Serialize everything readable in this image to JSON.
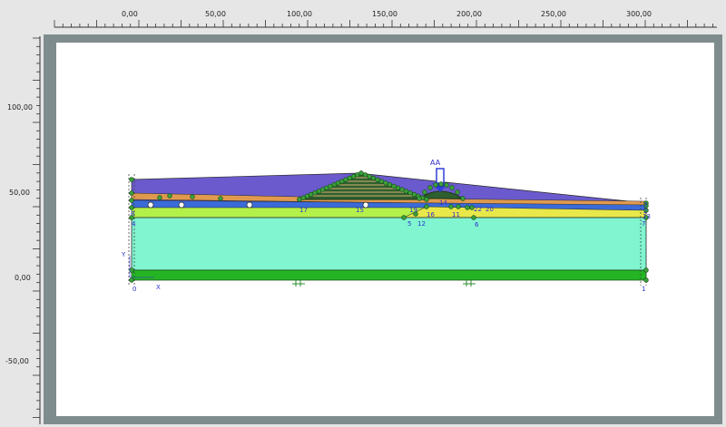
{
  "rulers": {
    "x_ticks": [
      "0,00",
      "50,00",
      "100,00",
      "150,00",
      "200,00",
      "250,00",
      "300,00"
    ],
    "y_ticks": [
      "100,00",
      "50,00",
      "0,00",
      "-50,00"
    ]
  },
  "model": {
    "load_label": "AA",
    "axis_x": "X",
    "axis_y": "Y",
    "point_labels": [
      "0",
      "1",
      "4",
      "7",
      "8",
      "5",
      "12",
      "6",
      "17",
      "15",
      "19",
      "11",
      "14",
      "22",
      "20",
      "13",
      "3",
      "2",
      "16"
    ]
  },
  "colors": {
    "frame": "#7f8c8d",
    "canvas": "#ffffff",
    "layer_purple": "#6a5acd",
    "layer_teal": "#80f5cf",
    "layer_green": "#24b424",
    "layer_yellow": "#e8e84a",
    "layer_lime": "#b4f04a",
    "embankment": "#d99a4a",
    "load_arrow": "#2f3fd8",
    "points": "#2e8b2e",
    "labels": "#3030d0"
  }
}
